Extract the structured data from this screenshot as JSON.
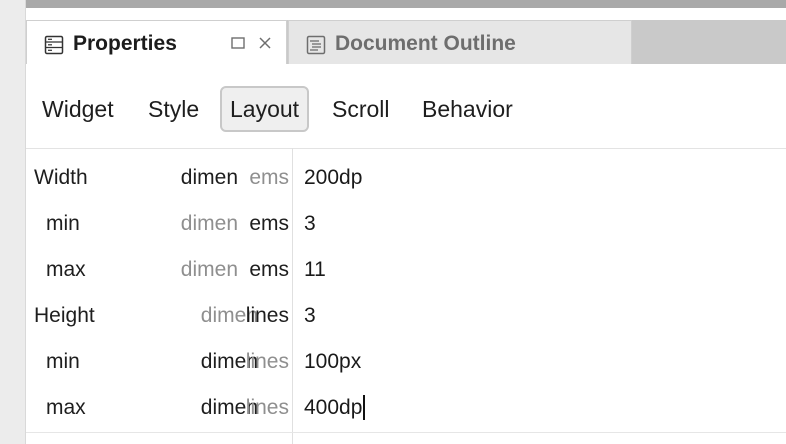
{
  "tabs": {
    "properties": {
      "label": "Properties",
      "icon": "properties-panel-icon"
    },
    "outline": {
      "label": "Document Outline",
      "icon": "document-outline-icon"
    },
    "maximize_icon": "maximize-icon",
    "close_icon": "close-icon"
  },
  "subtabs": [
    {
      "label": "Widget",
      "selected": false
    },
    {
      "label": "Style",
      "selected": false
    },
    {
      "label": "Layout",
      "selected": true
    },
    {
      "label": "Scroll",
      "selected": false
    },
    {
      "label": "Behavior",
      "selected": false
    }
  ],
  "rows": [
    {
      "name": "Width",
      "kind": "dimen",
      "unit": "ems",
      "value": "200dp",
      "active_part": "kind"
    },
    {
      "name": "min",
      "kind": "dimen",
      "unit": "ems",
      "value": "3",
      "active_part": "unit"
    },
    {
      "name": "max",
      "kind": "dimen",
      "unit": "ems",
      "value": "11",
      "active_part": "unit"
    },
    {
      "name": "Height",
      "kind": "dimen",
      "unit": "lines",
      "value": "3",
      "active_part": "unit"
    },
    {
      "name": "min",
      "kind": "dimen",
      "unit": "lines",
      "value": "100px",
      "active_part": "kind"
    },
    {
      "name": "max",
      "kind": "dimen",
      "unit": "lines",
      "value": "400dp",
      "active_part": "kind",
      "editing": true
    }
  ],
  "colors": {
    "active_text": "#1e1e1e",
    "muted_text": "#8f8f8f",
    "tab_bar": "#c9c9c9"
  }
}
